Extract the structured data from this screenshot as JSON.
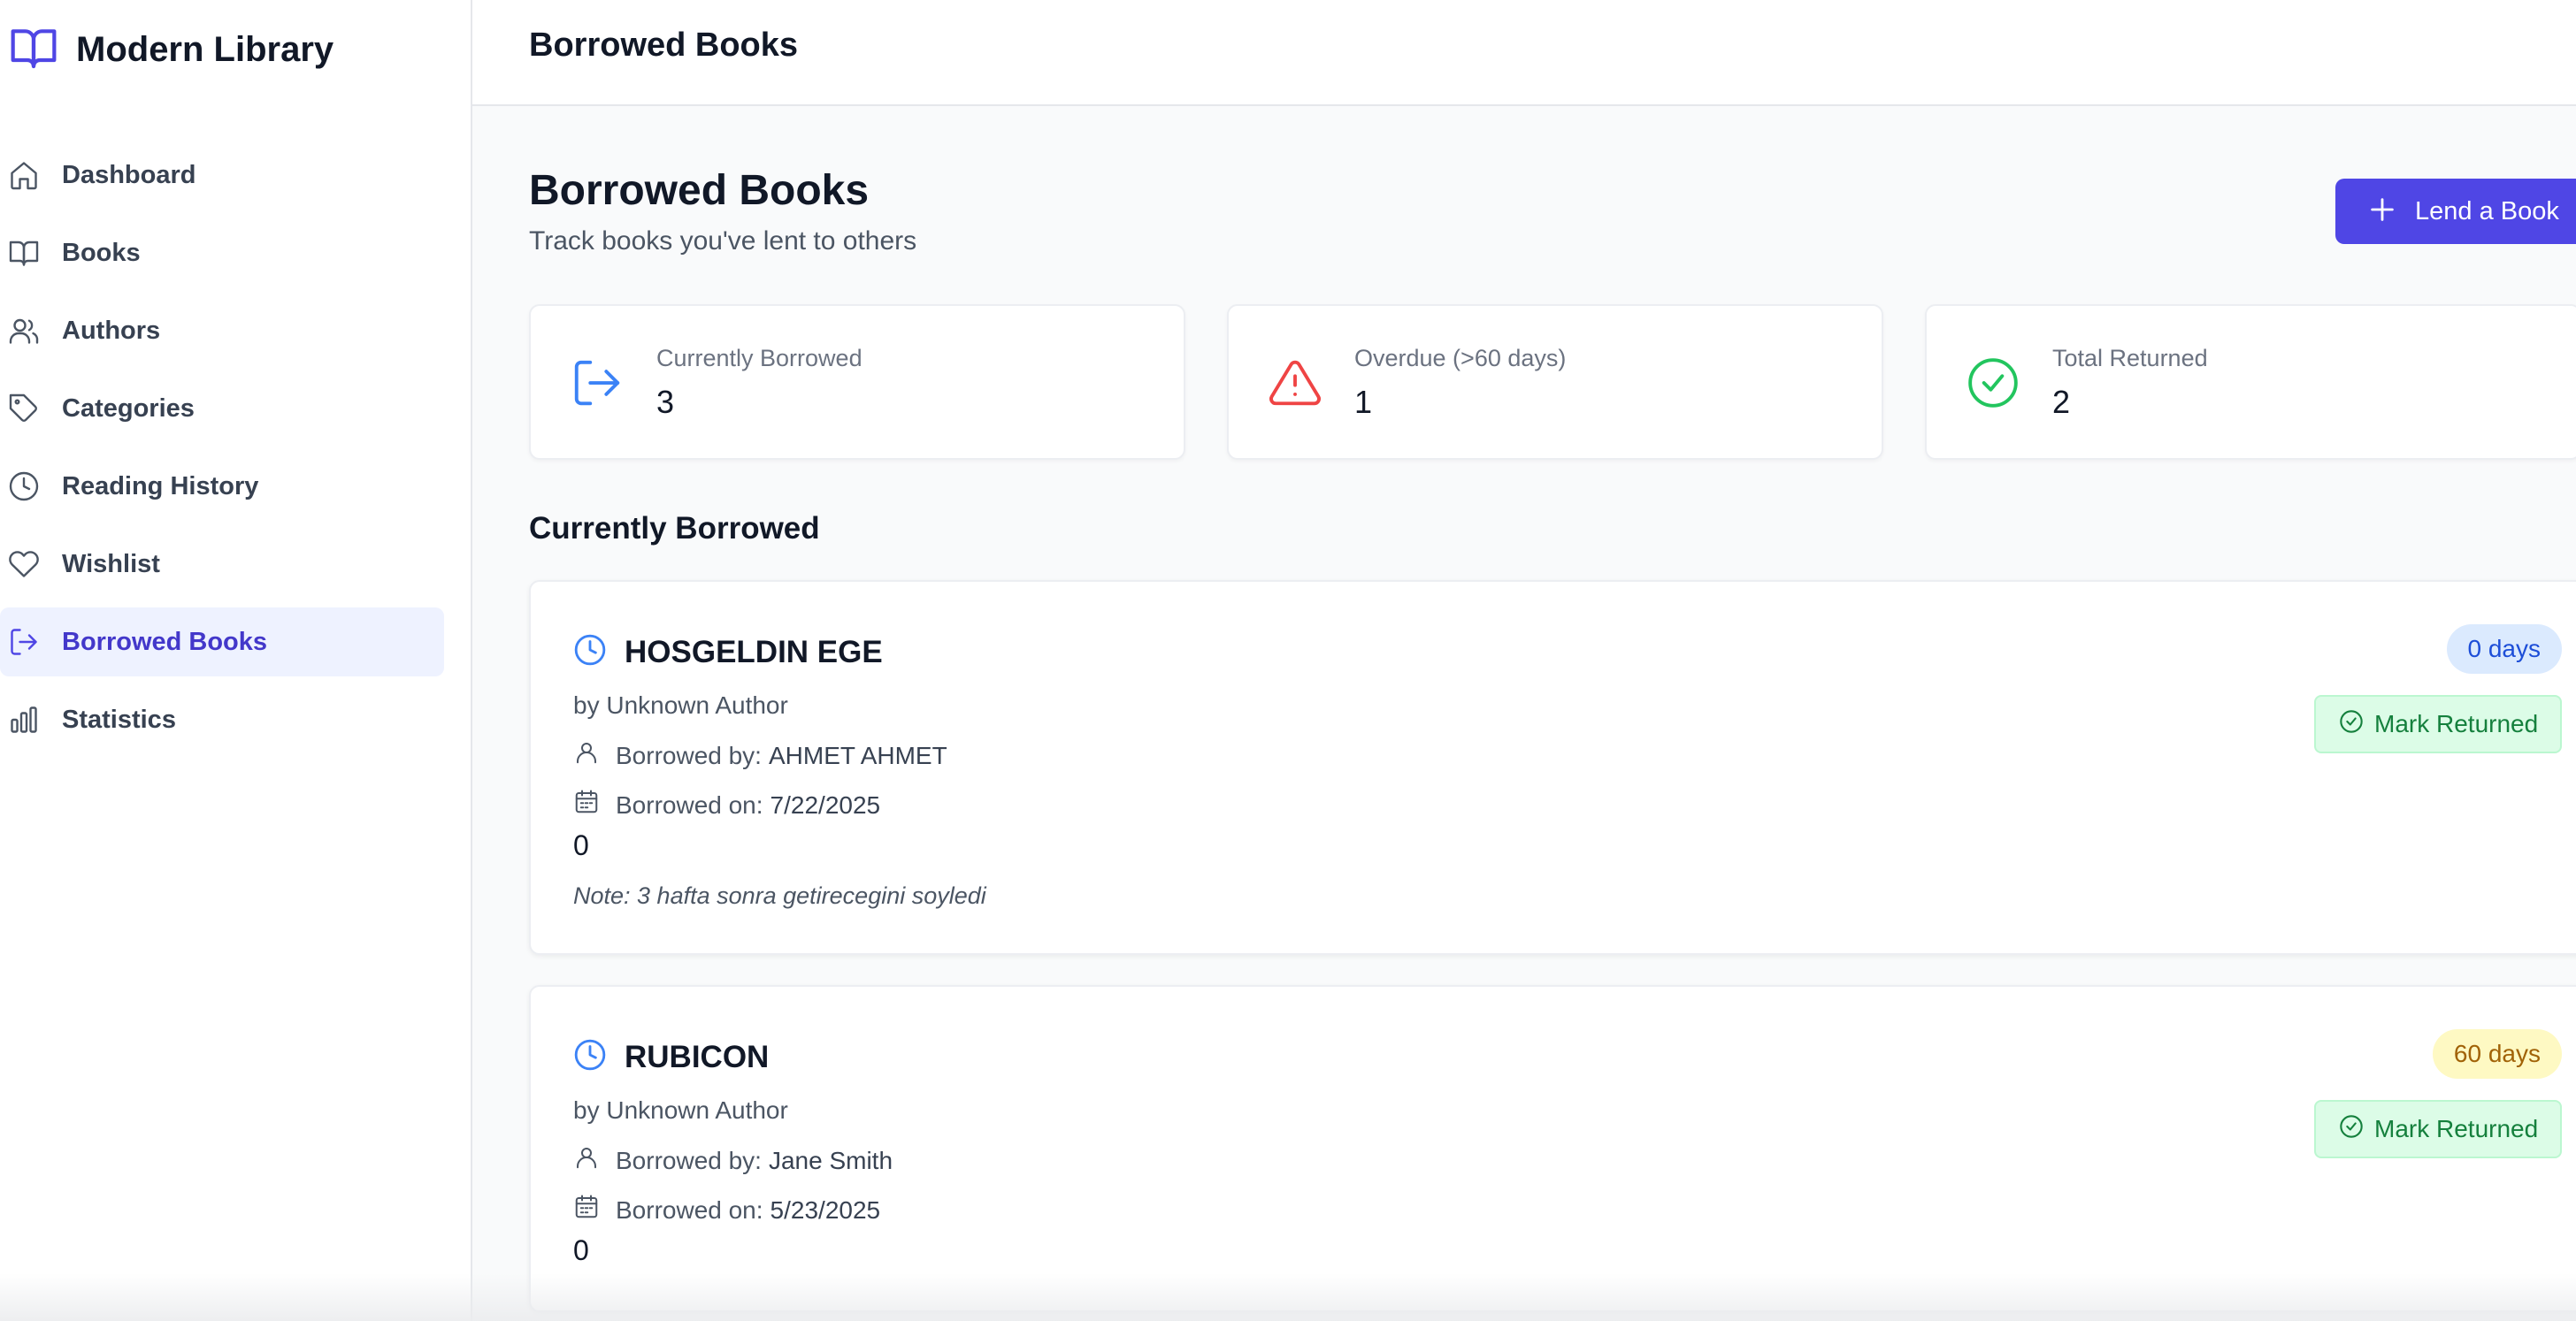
{
  "app": {
    "title": "Modern Library"
  },
  "sidebar": {
    "items": [
      {
        "label": "Dashboard",
        "icon": "home-icon"
      },
      {
        "label": "Books",
        "icon": "book-open-icon"
      },
      {
        "label": "Authors",
        "icon": "users-icon"
      },
      {
        "label": "Categories",
        "icon": "tag-icon"
      },
      {
        "label": "Reading History",
        "icon": "clock-icon"
      },
      {
        "label": "Wishlist",
        "icon": "heart-icon"
      },
      {
        "label": "Borrowed Books",
        "icon": "log-out-icon",
        "active": true
      },
      {
        "label": "Statistics",
        "icon": "bar-chart-icon"
      }
    ]
  },
  "header": {
    "title": "Borrowed Books"
  },
  "main": {
    "title": "Borrowed Books",
    "subtitle": "Track books you've lent to others",
    "lend_button": "Lend a Book"
  },
  "stats": [
    {
      "label": "Currently Borrowed",
      "value": "3",
      "icon": "log-out-icon",
      "color": "#3b82f6"
    },
    {
      "label": "Overdue (>60 days)",
      "value": "1",
      "icon": "alert-triangle-icon",
      "color": "#ef4444"
    },
    {
      "label": "Total Returned",
      "value": "2",
      "icon": "check-circle-icon",
      "color": "#22c55e"
    }
  ],
  "section": {
    "title": "Currently Borrowed"
  },
  "loans": [
    {
      "title": "HOSGELDIN EGE",
      "author": "by Unknown Author",
      "borrowed_by_label": "Borrowed by:",
      "borrowed_by": "AHMET AHMET",
      "borrowed_on_label": "Borrowed on:",
      "borrowed_on": "7/22/2025",
      "count": "0",
      "note": "Note: 3 hafta sonra getirecegini soyledi",
      "days": "0 days",
      "action": "Mark Returned"
    },
    {
      "title": "RUBICON",
      "author": "by Unknown Author",
      "borrowed_by_label": "Borrowed by:",
      "borrowed_by": "Jane Smith",
      "borrowed_on_label": "Borrowed on:",
      "borrowed_on": "5/23/2025",
      "count": "0",
      "days": "60 days",
      "action": "Mark Returned"
    }
  ],
  "colors": {
    "accent": "#4f46e5",
    "active_nav_bg": "#eef2ff",
    "active_nav_text": "#4338ca",
    "badge_blue": "#dbeafe",
    "badge_yellow": "#fef9c3",
    "mark_returned_bg": "#dcfce7"
  }
}
